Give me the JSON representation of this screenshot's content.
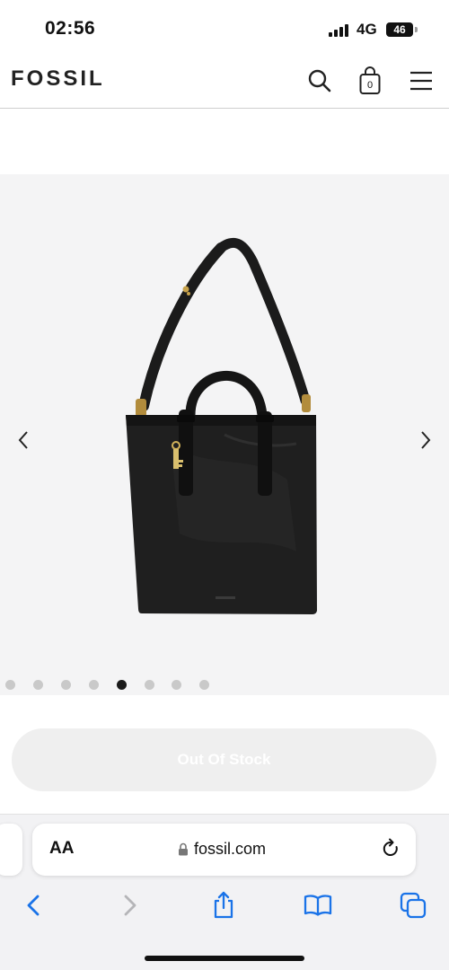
{
  "status_bar": {
    "time": "02:56",
    "network": "4G",
    "battery": "46",
    "signal_icon": "cellular-signal-icon"
  },
  "header": {
    "logo": "FOSSIL",
    "search_icon": "search-icon",
    "cart_icon": "shopping-bag-icon",
    "cart_count": "0",
    "menu_icon": "hamburger-menu-icon"
  },
  "gallery": {
    "image": "black-leather-tote-bag-image",
    "prev_icon": "chevron-left-icon",
    "next_icon": "chevron-right-icon",
    "slide_count": 8,
    "active_slide": 5
  },
  "product": {
    "cta_label": "Out Of Stock"
  },
  "browser": {
    "text_size_label": "AA",
    "url": "fossil.com",
    "lock_icon": "lock-icon",
    "reload_icon": "reload-icon",
    "toolbar": [
      "back-icon",
      "forward-icon",
      "share-icon",
      "bookmarks-icon",
      "tabs-icon"
    ]
  },
  "colors": {
    "gallery_bg": "#f4f4f5",
    "accent_blue": "#1a73e8",
    "cta_bg": "#efefef"
  }
}
